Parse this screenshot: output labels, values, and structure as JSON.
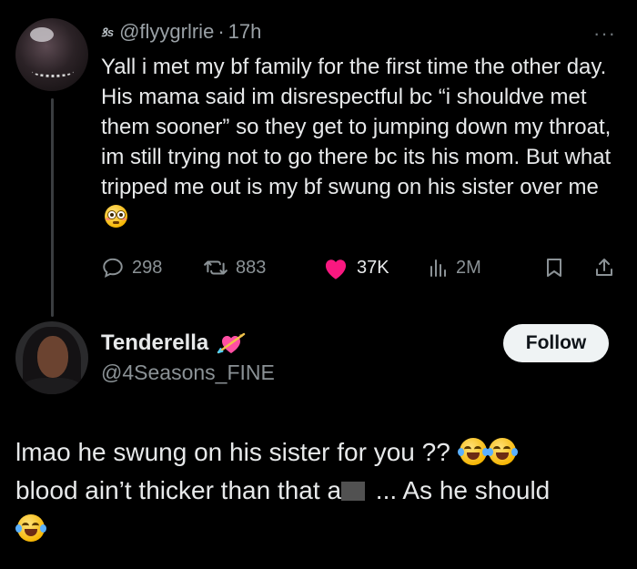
{
  "first_tweet": {
    "handle": "@flyygrlrie",
    "separator": "·",
    "time": "17h",
    "verified_badge": "ꝸs",
    "more_menu": "···",
    "text": "Yall i met my bf family for the first time the other day. His mama said im disrespectful bc “i shouldve met them sooner” so they get to jumping down my throat, im still trying not to go there bc its his mom. But what tripped me out is my bf swung on his sister over me",
    "trailing_emoji": "flushed-face",
    "actions": {
      "replies": "298",
      "reposts": "883",
      "likes": "37K",
      "views": "2M"
    },
    "like_color": "#f91880"
  },
  "second_tweet": {
    "display_name": "Tenderella",
    "name_emoji": "heart-with-arrow",
    "handle": "@4Seasons_FINE",
    "follow_label": "Follow",
    "text_part1": "lmao he swung on his sister for you ??",
    "text_part2": "blood ain’t thicker than that a",
    "text_part3": " ... As he should",
    "emojis": [
      "face-with-tears-of-joy",
      "face-with-tears-of-joy",
      "face-with-tears-of-joy"
    ]
  },
  "colors": {
    "background": "#000000",
    "primary_text": "#e7e9ea",
    "secondary_text": "#8b9296",
    "follow_button_bg": "#eff3f4"
  }
}
